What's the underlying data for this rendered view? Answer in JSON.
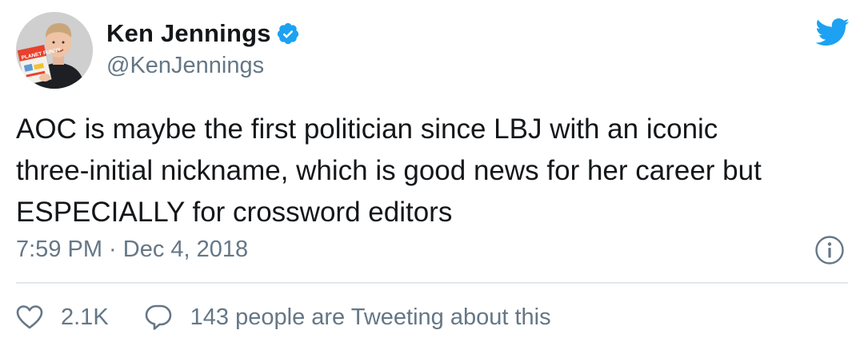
{
  "author": {
    "display_name": "Ken Jennings",
    "handle": "@KenJennings",
    "verified": true,
    "avatar_book_text": "PLANET FUNNY"
  },
  "tweet": {
    "text": "AOC is maybe the first politician since LBJ with an iconic\nthree-initial nickname, which is good news for her career but\nESPECIALLY for crossword editors",
    "timestamp": "7:59 PM · Dec 4, 2018"
  },
  "engagement": {
    "likes": "2.1K",
    "tweeting_text": "143 people are Tweeting about this"
  },
  "icons": {
    "brand": "twitter-bird-icon",
    "verified": "verified-badge-icon",
    "info": "info-icon",
    "like": "heart-icon",
    "reply": "speech-bubble-icon"
  },
  "colors": {
    "brand_blue": "#1da1f2",
    "text_primary": "#14171a",
    "text_secondary": "#657786",
    "divider": "#e1e8ed"
  }
}
